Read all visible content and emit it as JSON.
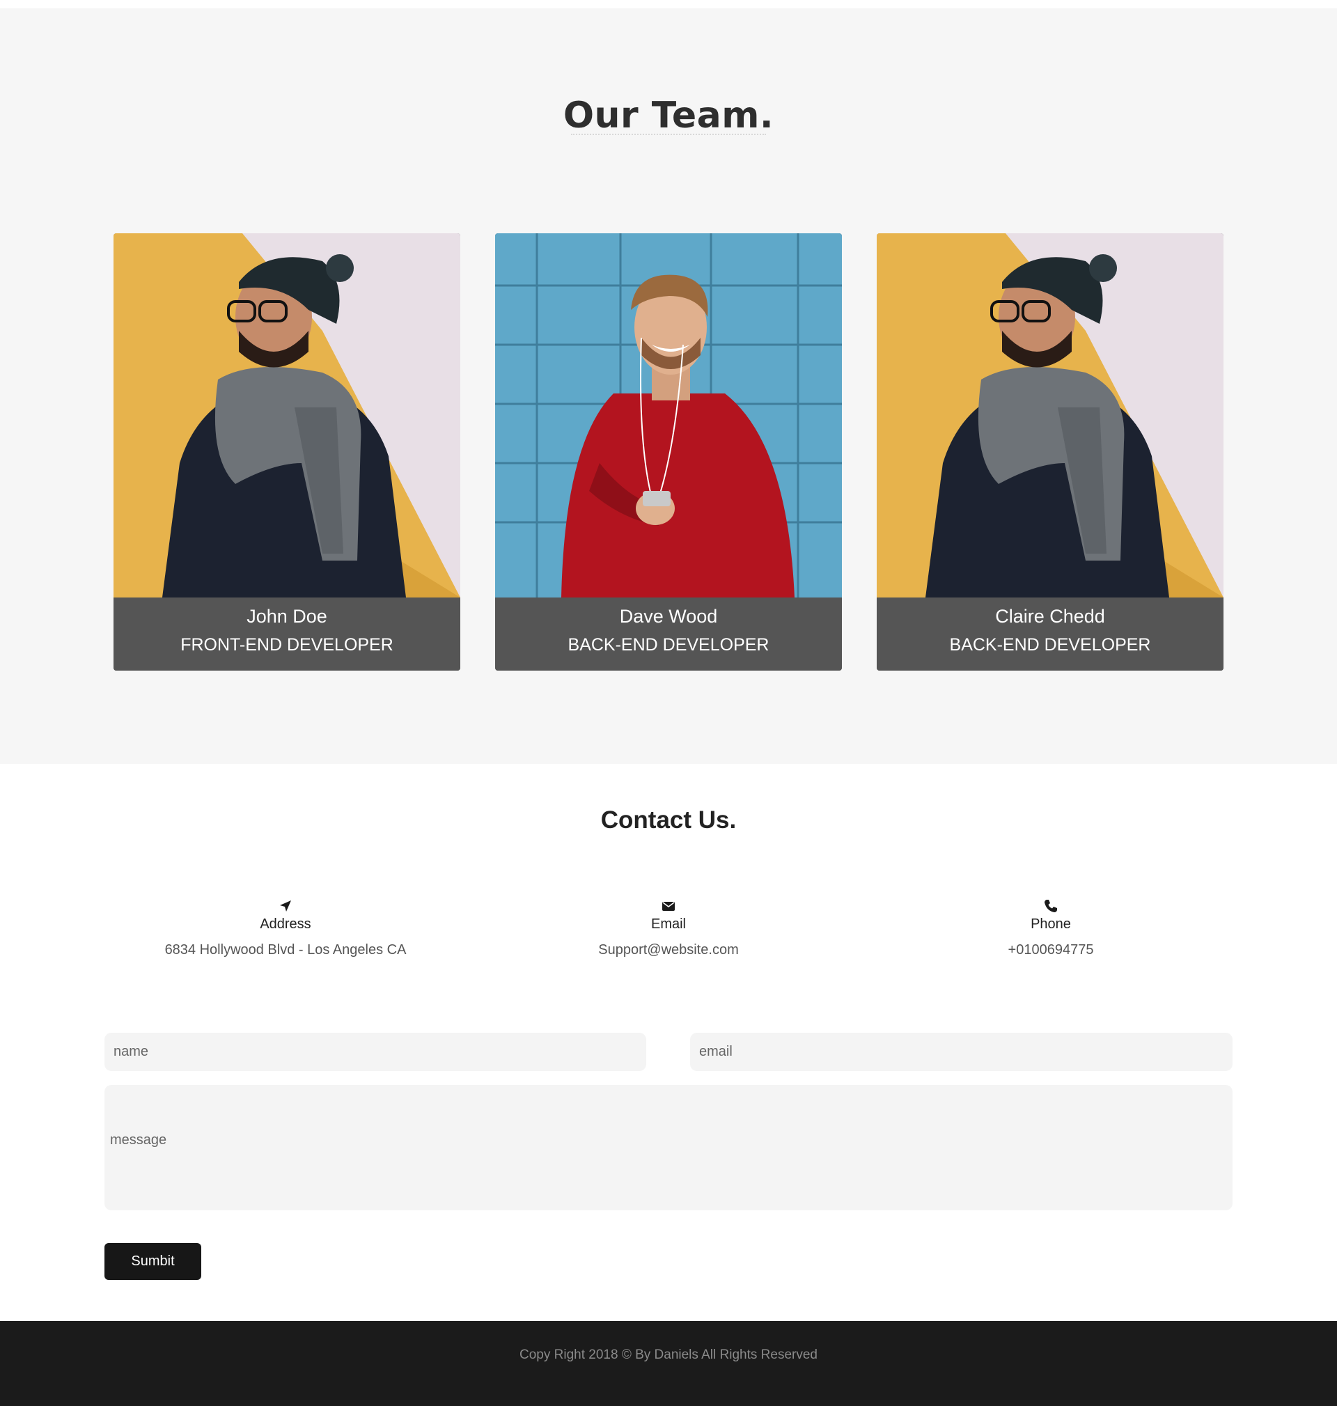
{
  "team": {
    "title": "Our Team.",
    "members": [
      {
        "name": "John Doe",
        "role": "FRONT-END DEVELOPER",
        "photo": "man-beanie-scarf-photo"
      },
      {
        "name": "Dave Wood",
        "role": "BACK-END DEVELOPER",
        "photo": "man-red-sweater-photo"
      },
      {
        "name": "Claire Chedd",
        "role": "BACK-END DEVELOPER",
        "photo": "man-beanie-scarf-photo"
      }
    ]
  },
  "contact": {
    "title": "Contact Us.",
    "info": [
      {
        "icon": "location-arrow-icon",
        "label": "Address",
        "value": "6834 Hollywood Blvd - Los Angeles CA"
      },
      {
        "icon": "envelope-icon",
        "label": "Email",
        "value": "Support@website.com"
      },
      {
        "icon": "phone-icon",
        "label": "Phone",
        "value": "+0100694775"
      }
    ],
    "form": {
      "name_placeholder": "name",
      "email_placeholder": "email",
      "message_placeholder": "message",
      "submit_label": "Sumbit"
    }
  },
  "footer": {
    "text": "Copy Right 2018 © By Daniels All Rights Reserved"
  },
  "colors": {
    "team_bg": "#f6f6f6",
    "caption_bg": "#555555",
    "button_bg": "#171717",
    "footer_bg": "#1b1b1b",
    "input_bg": "#f4f4f4"
  }
}
